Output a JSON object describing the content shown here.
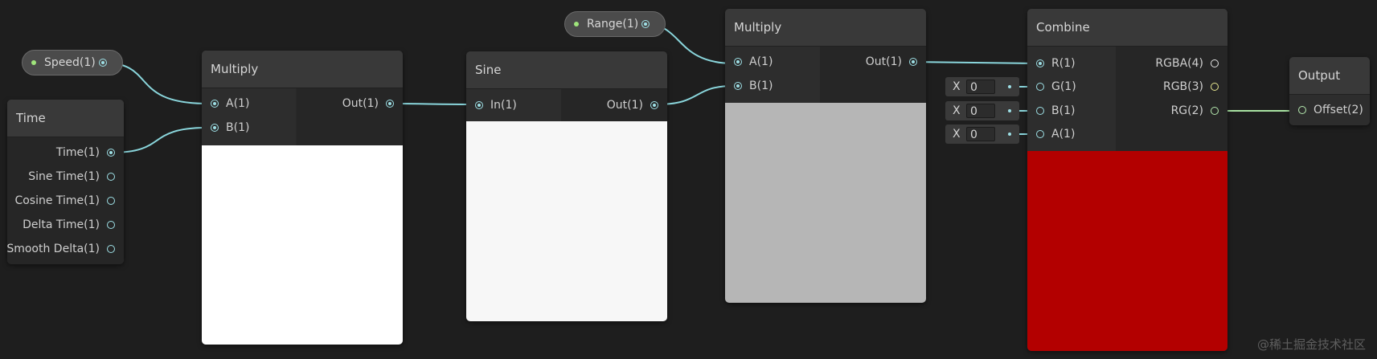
{
  "properties": {
    "speed": "Speed(1)",
    "range": "Range(1)"
  },
  "time_node": {
    "title": "Time",
    "outputs": [
      "Time(1)",
      "Sine Time(1)",
      "Cosine Time(1)",
      "Delta Time(1)",
      "Smooth Delta(1)"
    ]
  },
  "multiply_node_1": {
    "title": "Multiply",
    "inputs": [
      "A(1)",
      "B(1)"
    ],
    "output": "Out(1)",
    "preview_color": "#ffffff"
  },
  "sine_node": {
    "title": "Sine",
    "input": "In(1)",
    "output": "Out(1)",
    "preview_color": "#f7f7f7"
  },
  "multiply_node_2": {
    "title": "Multiply",
    "inputs": [
      "A(1)",
      "B(1)"
    ],
    "output": "Out(1)",
    "preview_color": "#b6b6b6"
  },
  "combine_node": {
    "title": "Combine",
    "inputs": [
      "R(1)",
      "G(1)",
      "B(1)",
      "A(1)"
    ],
    "outputs": [
      "RGBA(4)",
      "RGB(3)",
      "RG(2)"
    ],
    "defaults": [
      {
        "label": "X",
        "value": "0"
      },
      {
        "label": "X",
        "value": "0"
      },
      {
        "label": "X",
        "value": "0"
      }
    ],
    "preview_color": "#b30000"
  },
  "output_node": {
    "title": "Output",
    "input": "Offset(2)"
  },
  "colors": {
    "wire": "#8ad6dc",
    "wire_output": "#a8e3a2",
    "background": "#1e1e1e"
  },
  "watermark": "@稀土掘金技术社区"
}
